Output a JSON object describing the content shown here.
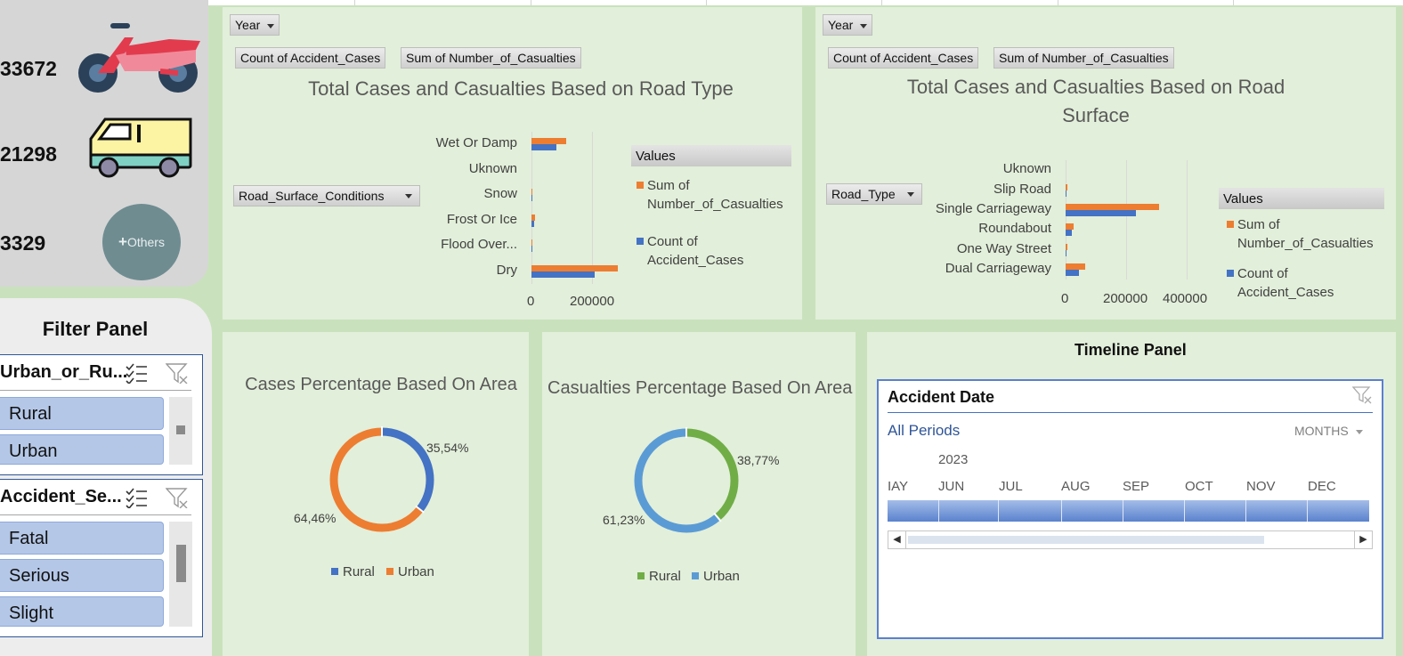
{
  "kpis": [
    {
      "value": "33672",
      "icon": "motorcycle-icon"
    },
    {
      "value": "21298",
      "icon": "van-icon"
    },
    {
      "value": "3329",
      "icon": "others-icon",
      "icon_label": "Others"
    }
  ],
  "filter_panel": {
    "title": "Filter Panel",
    "slicers": [
      {
        "name": "Urban_or_Ru...",
        "items": [
          "Rural",
          "Urban"
        ]
      },
      {
        "name": "Accident_Se...",
        "items": [
          "Fatal",
          "Serious",
          "Slight"
        ]
      }
    ]
  },
  "road_type_chart": {
    "year_filter": "Year",
    "field_buttons": [
      "Count of Accident_Cases",
      "Sum of Number_of_Casualties"
    ],
    "axis_field": "Road_Surface_Conditions",
    "legend_title": "Values",
    "legend": [
      "Sum of Number_of_Casualties",
      "Count of Accident_Cases"
    ],
    "x_ticks": [
      "0",
      "200000"
    ]
  },
  "road_surface_chart": {
    "year_filter": "Year",
    "field_buttons": [
      "Count of Accident_Cases",
      "Sum of Number_of_Casualties"
    ],
    "axis_field": "Road_Type",
    "legend_title": "Values",
    "legend": [
      "Sum of Number_of_Casualties",
      "Count of Accident_Cases"
    ],
    "x_ticks": [
      "0",
      "200000",
      "400000"
    ]
  },
  "cases_area_chart": {
    "labels": [
      "35,54%",
      "64,46%"
    ],
    "legend": [
      "Rural",
      "Urban"
    ]
  },
  "casualties_area_chart": {
    "labels": [
      "38,77%",
      "61,23%"
    ],
    "legend": [
      "Rural",
      "Urban"
    ]
  },
  "timeline": {
    "panel_title": "Timeline Panel",
    "header": "Accident Date",
    "all_periods": "All Periods",
    "level": "MONTHS",
    "year": "2023",
    "months": [
      "IAY",
      "JUN",
      "JUL",
      "AUG",
      "SEP",
      "OCT",
      "NOV",
      "DEC"
    ]
  },
  "colors": {
    "cases": "#4472c4",
    "casualties": "#ed7d31",
    "rural_cases": "#4472c4",
    "urban_cases": "#ed7d31",
    "rural_casualties": "#70ad47",
    "urban_casualties": "#5b9bd5",
    "panel_bg": "#e2efda"
  },
  "chart_data": [
    {
      "type": "bar",
      "orientation": "horizontal",
      "title": "Total Cases and Casualties Based on Road Type",
      "categories": [
        "Wet Or Damp",
        "Uknown",
        "Snow",
        "Frost Or Ice",
        "Flood Over...",
        "Dry"
      ],
      "series": [
        {
          "name": "Sum of Number_of_Casualties",
          "values": [
            115000,
            0,
            2000,
            12000,
            800,
            285000
          ]
        },
        {
          "name": "Count of Accident_Cases",
          "values": [
            82000,
            0,
            1500,
            9000,
            600,
            210000
          ]
        }
      ],
      "xlim": [
        0,
        200000
      ],
      "legend_position": "right"
    },
    {
      "type": "bar",
      "orientation": "horizontal",
      "title": "Total Cases and Casualties Based on Road Surface",
      "categories": [
        "Uknown",
        "Slip Road",
        "Single Carriageway",
        "Roundabout",
        "One Way Street",
        "Dual Carriageway"
      ],
      "series": [
        {
          "name": "Sum of Number_of_Casualties",
          "values": [
            0,
            5000,
            310000,
            27000,
            5000,
            66000
          ]
        },
        {
          "name": "Count of Accident_Cases",
          "values": [
            0,
            4000,
            232000,
            20000,
            4000,
            45000
          ]
        }
      ],
      "xlim": [
        0,
        400000
      ],
      "legend_position": "right"
    },
    {
      "type": "pie",
      "donut": true,
      "title": "Cases Percentage Based On Area",
      "categories": [
        "Rural",
        "Urban"
      ],
      "values": [
        35.54,
        64.46
      ],
      "legend_position": "bottom"
    },
    {
      "type": "pie",
      "donut": true,
      "title": "Casualties Percentage Based On Area",
      "categories": [
        "Rural",
        "Urban"
      ],
      "values": [
        38.77,
        61.23
      ],
      "legend_position": "bottom"
    }
  ]
}
